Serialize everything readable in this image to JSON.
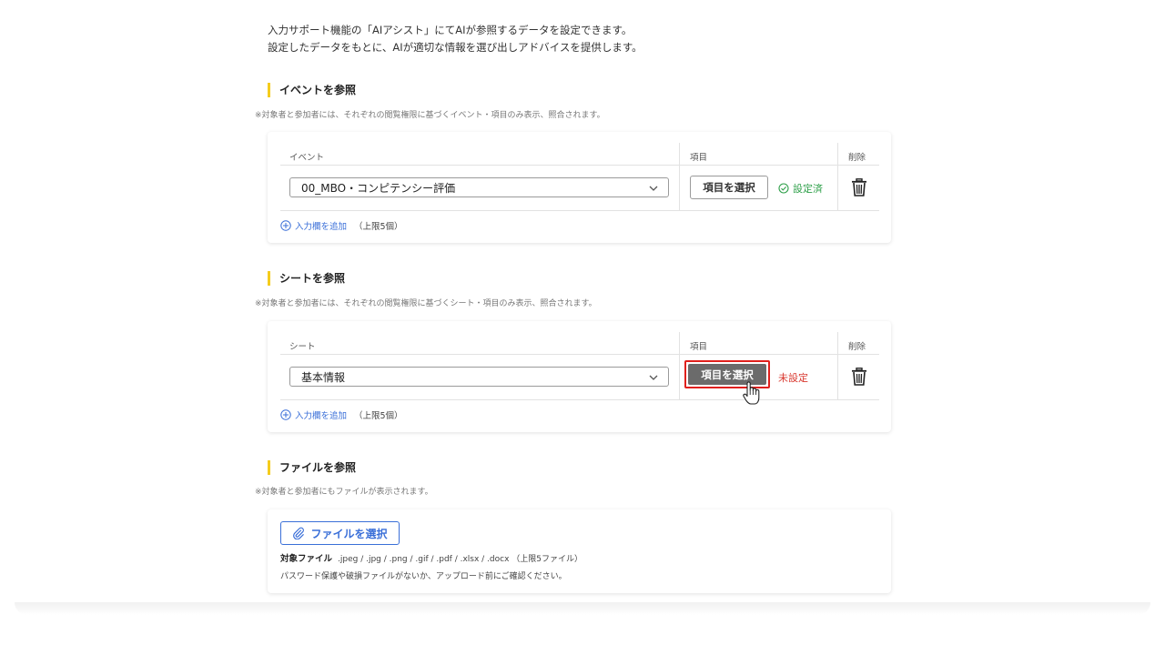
{
  "intro": {
    "line1": "入力サポート機能の「AIアシスト」にてAIが参照するデータを設定できます。",
    "line2": "設定したデータをもとに、AIが適切な情報を選び出しアドバイスを提供します。"
  },
  "event_section": {
    "title": "イベントを参照",
    "note": "※対象者と参加者には、それぞれの閲覧権限に基づくイベント・項目のみ表示、照合されます。",
    "col_event": "イベント",
    "col_item": "項目",
    "col_delete": "削除",
    "selected_event": "00_MBO・コンピテンシー評価",
    "select_items_label": "項目を選択",
    "status": "設定済",
    "add_label": "入力欄を追加",
    "add_limit": "（上限5個）"
  },
  "sheet_section": {
    "title": "シートを参照",
    "note": "※対象者と参加者には、それぞれの閲覧権限に基づくシート・項目のみ表示、照合されます。",
    "col_sheet": "シート",
    "col_item": "項目",
    "col_delete": "削除",
    "selected_sheet": "基本情報",
    "select_items_label": "項目を選択",
    "status": "未設定",
    "add_label": "入力欄を追加",
    "add_limit": "（上限5個）"
  },
  "file_section": {
    "title": "ファイルを参照",
    "note": "※対象者と参加者にもファイルが表示されます。",
    "select_file_label": "ファイルを選択",
    "target_label": "対象ファイル",
    "target_types": ".jpeg / .jpg / .png / .gif / .pdf / .xlsx / .docx （上限5ファイル）",
    "caution": "パスワード保護や破損ファイルがないか、アップロード前にご確認ください。"
  },
  "colors": {
    "accent_yellow": "#f5cc1d",
    "link_blue": "#3a6fd8",
    "ok_green": "#2fa04a",
    "ng_red": "#d9382f",
    "highlight_red": "#e0201c"
  }
}
